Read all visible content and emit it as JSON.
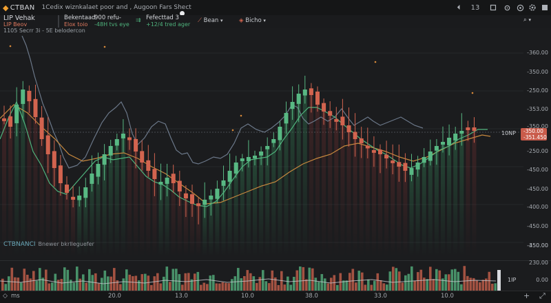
{
  "app": {
    "brand": "CTBAN",
    "title": "1Cedix wiznkalaet poor and , Augoon Fars Shect",
    "toolbar_count": "13"
  },
  "info": {
    "symbol": "LIP Vehak",
    "symbol_sub": "LIP Beov",
    "stat1_label": "Bekentaad",
    "stat1_sub": "Elox toio",
    "stat2_label": "900 refu-",
    "stat2_sub": "-48H tvs eye",
    "stat3_label": "Fefecttad 3",
    "stat3_sub": "+12/4 tred ager",
    "dropdown1": "Bean",
    "dropdown2": "Bicho",
    "symbol_line": "1105 Secrr 3i - 5E belodercon"
  },
  "chart": {
    "price_axis_labels": [
      "-360.00",
      "-350.00",
      "-250.00",
      "-353.00",
      "-350.00",
      "-250.00",
      "-450.00",
      "-450.00",
      "-400.00",
      "-450.00",
      "-450.00",
      "-350.00"
    ],
    "current_price_tag": "-350.00",
    "current_price_sub": "-351.450",
    "current_marker": "10NP",
    "watermark": "CTBNANCI",
    "watermark_sub": "Bnewer bkrlleguefer",
    "colors": {
      "up": "#58b883",
      "down": "#d2644f",
      "ma_fast": "#4fb47d",
      "ma_slow": "#c98a3f",
      "overlay": "#8797ad"
    }
  },
  "volume": {
    "axis_top": "230.00",
    "axis_mid": "0.00",
    "axis_marker": "1IP"
  },
  "time_axis": {
    "left_label": "ms",
    "labels": [
      "20.0",
      "13.0",
      "10.0",
      "38.0",
      "33.0",
      "10.0"
    ]
  }
}
